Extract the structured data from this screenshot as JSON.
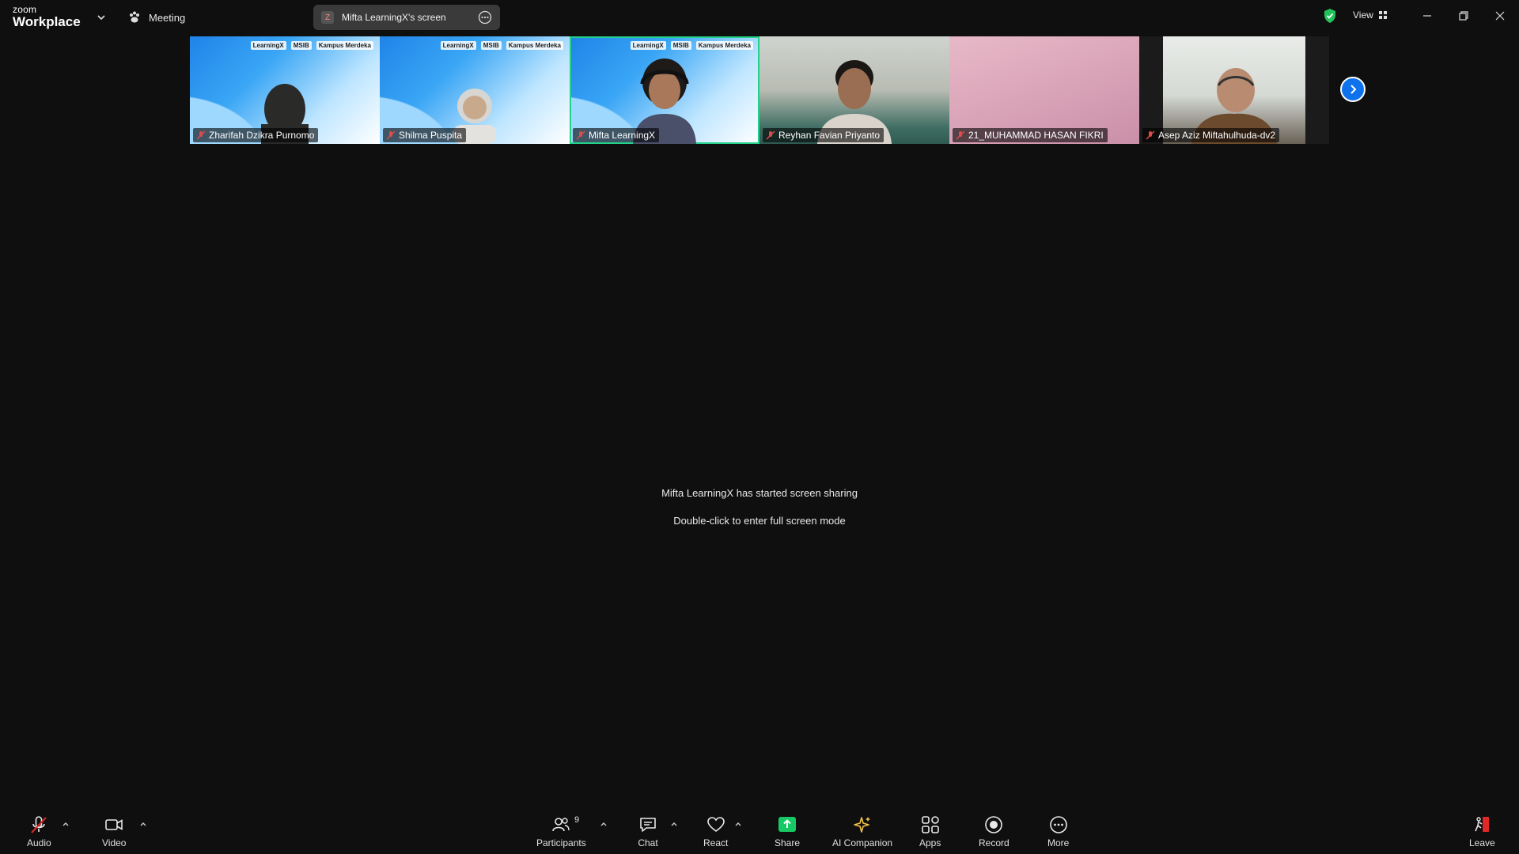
{
  "titlebar": {
    "logo_small": "zoom",
    "logo_big": "Workplace",
    "meeting_label": "Meeting",
    "share_badge": "Z",
    "share_title": "Mifta LearningX's screen",
    "view_label": "View"
  },
  "participants_strip": [
    {
      "name": "Zharifah Dzikra Purnomo",
      "bg": "blue",
      "brand": true
    },
    {
      "name": "Shilma Puspita",
      "bg": "blue",
      "brand": true
    },
    {
      "name": "Mifta LearningX",
      "bg": "blue",
      "brand": true,
      "active": true
    },
    {
      "name": "Reyhan Favian Priyanto",
      "bg": "room",
      "brand": false
    },
    {
      "name": "21_MUHAMMAD HASAN FIKRI",
      "bg": "pink",
      "brand": false
    },
    {
      "name": "Asep Aziz Miftahulhuda-dv2",
      "bg": "room",
      "brand": false
    }
  ],
  "brand_marks": [
    "LearningX",
    "MSIB",
    "Kampus Merdeka"
  ],
  "center": {
    "line1": "Mifta LearningX has started screen sharing",
    "line2": "Double-click to enter full screen mode"
  },
  "toolbar": {
    "audio": "Audio",
    "video": "Video",
    "participants": "Participants",
    "participants_count": "9",
    "chat": "Chat",
    "react": "React",
    "share": "Share",
    "ai_companion": "AI Companion",
    "apps": "Apps",
    "record": "Record",
    "more": "More",
    "leave": "Leave"
  },
  "colors": {
    "accent_green": "#23d18b",
    "share_green": "#17c964",
    "leave_red": "#e02828",
    "ai_gold": "#f5c542",
    "blue_button": "#0e72ed"
  }
}
